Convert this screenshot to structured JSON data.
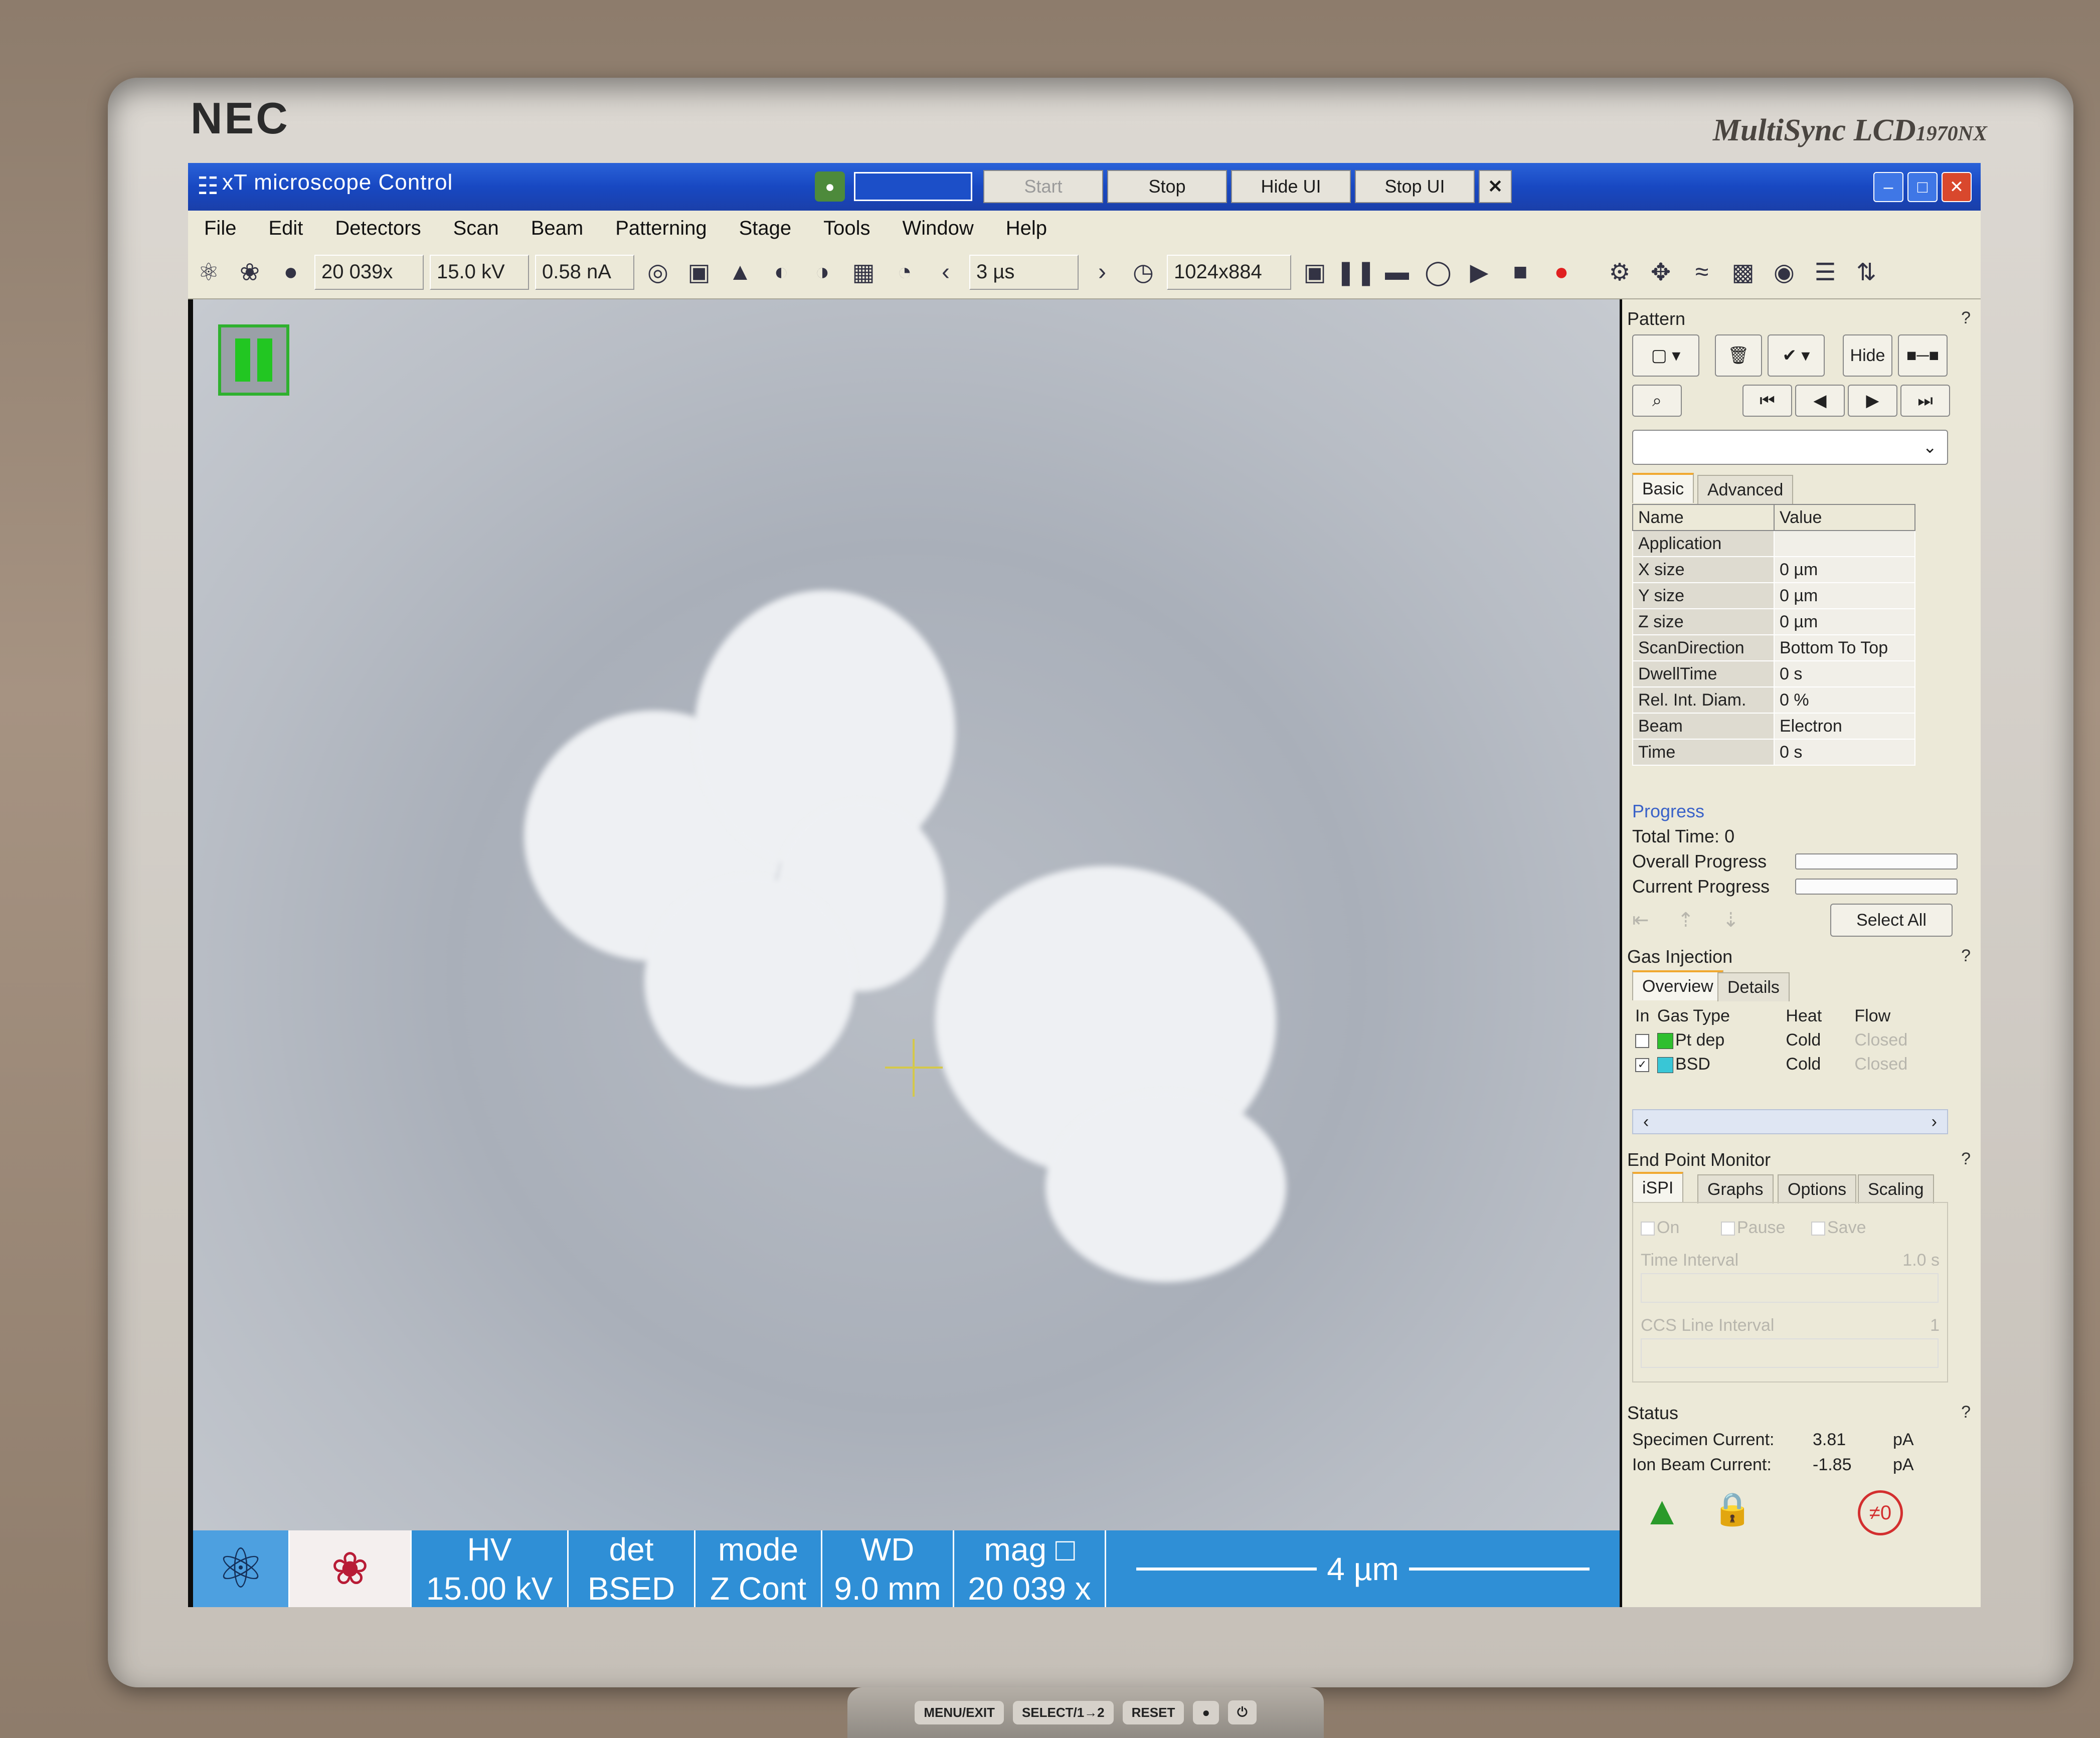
{
  "monitor": {
    "brand": "NEC",
    "model": "MultiSync LCD",
    "model_suffix": "1970NX",
    "buttons": [
      "MENU/EXIT",
      "SELECT/1→2",
      "RESET",
      "●",
      "⏻"
    ]
  },
  "window": {
    "title": "xT microscope Control",
    "controls": [
      {
        "label": "Start",
        "enabled": false
      },
      {
        "label": "Stop",
        "enabled": true
      },
      {
        "label": "Hide UI",
        "enabled": true
      },
      {
        "label": "Stop UI",
        "enabled": true
      }
    ],
    "close_glyph": "✕"
  },
  "menu": [
    "File",
    "Edit",
    "Detectors",
    "Scan",
    "Beam",
    "Patterning",
    "Stage",
    "Tools",
    "Window",
    "Help"
  ],
  "toolbar": {
    "magnification": "20 039x",
    "voltage": "15.0 kV",
    "current": "0.58 nA",
    "dwell": "3 µs",
    "resolution": "1024x884"
  },
  "info_bar": [
    {
      "label": "HV",
      "value": "15.00 kV"
    },
    {
      "label": "det",
      "value": "BSED"
    },
    {
      "label": "mode",
      "value": "Z Cont"
    },
    {
      "label": "WD",
      "value": "9.0 mm"
    },
    {
      "label": "mag",
      "value": "20 039 x"
    }
  ],
  "scale_bar": "4 µm",
  "pattern": {
    "header": "Pattern",
    "help": "?",
    "hide_label": "Hide",
    "tabs": [
      "Basic",
      "Advanced"
    ],
    "columns": [
      "Name",
      "Value"
    ],
    "rows": [
      {
        "name": "Application",
        "value": ""
      },
      {
        "name": "X size",
        "value": "0 µm"
      },
      {
        "name": "Y size",
        "value": "0 µm"
      },
      {
        "name": "Z size",
        "value": "0 µm"
      },
      {
        "name": "ScanDirection",
        "value": "Bottom To Top"
      },
      {
        "name": "DwellTime",
        "value": "0 s"
      },
      {
        "name": "Rel. Int. Diam.",
        "value": "0 %"
      },
      {
        "name": "Beam",
        "value": "Electron"
      },
      {
        "name": "Time",
        "value": "0 s"
      }
    ],
    "progress_header": "Progress",
    "total_time_label": "Total Time:",
    "total_time": "0",
    "overall_label": "Overall Progress",
    "current_label": "Current Progress",
    "select_all": "Select All"
  },
  "gas_injection": {
    "header": "Gas Injection",
    "help": "?",
    "tabs": [
      "Overview",
      "Details"
    ],
    "columns": [
      "In",
      "Gas Type",
      "Heat",
      "Flow"
    ],
    "rows": [
      {
        "checked": false,
        "gas": "Pt dep",
        "color": "#2fbf2f",
        "heat": "Cold",
        "flow": "Closed"
      },
      {
        "checked": true,
        "gas": "BSD",
        "color": "#39c6d6",
        "heat": "Cold",
        "flow": "Closed"
      }
    ]
  },
  "end_point": {
    "header": "End Point Monitor",
    "help": "?",
    "tabs": [
      "iSPI",
      "Graphs",
      "Options",
      "Scaling"
    ],
    "checks": [
      "On",
      "Pause",
      "Save"
    ],
    "time_interval_label": "Time Interval",
    "time_interval_value": "1.0 s",
    "ccs_label": "CCS Line Interval",
    "ccs_value": "1"
  },
  "status": {
    "header": "Status",
    "help": "?",
    "specimen_label": "Specimen Current:",
    "specimen_value": "3.81",
    "specimen_unit": "pA",
    "ion_label": "Ion Beam Current:",
    "ion_value": "-1.85",
    "ion_unit": "pA",
    "zero_label": "≠0"
  }
}
